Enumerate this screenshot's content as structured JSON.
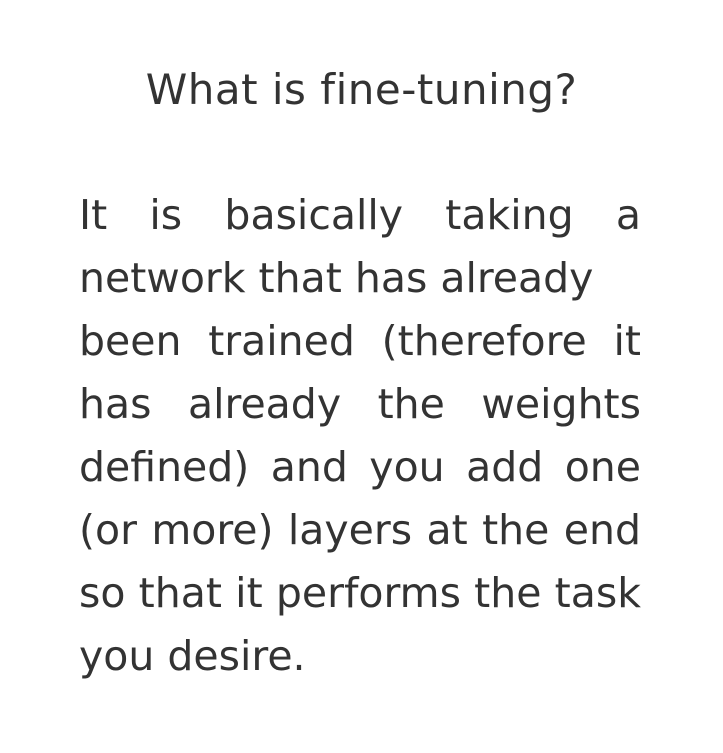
{
  "heading": "What is fine-tuning?",
  "paragraph": {
    "lines": [
      "It is basically taking a",
      "network that has already",
      "been trained (therefore it",
      "has already the weights",
      "defined) and you add one",
      "(or more) layers at the end",
      "so that it performs the task",
      "you desire."
    ]
  }
}
